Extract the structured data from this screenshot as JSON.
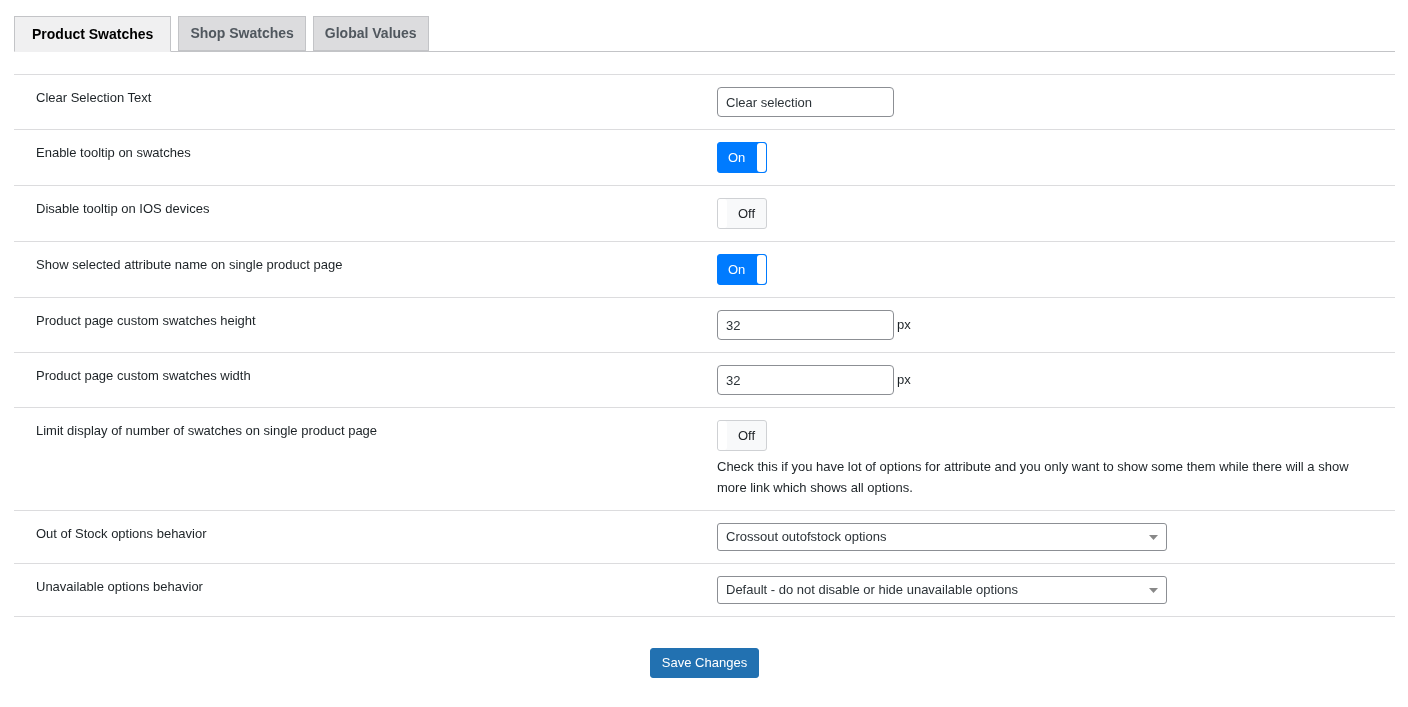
{
  "tabs": [
    {
      "label": "Product Swatches",
      "selected": true
    },
    {
      "label": "Shop Swatches",
      "selected": false
    },
    {
      "label": "Global Values",
      "selected": false
    }
  ],
  "settings": [
    {
      "kind": "text",
      "label": "Clear Selection Text",
      "value": "Clear selection"
    },
    {
      "kind": "toggle",
      "label": "Enable tooltip on swatches",
      "on": true,
      "text": "On"
    },
    {
      "kind": "toggle",
      "label": "Disable tooltip on IOS devices",
      "on": false,
      "text": "Off"
    },
    {
      "kind": "toggle",
      "label": "Show selected attribute name on single product page",
      "on": true,
      "text": "On"
    },
    {
      "kind": "number",
      "label": "Product page custom swatches height",
      "value": "32",
      "unit": "px"
    },
    {
      "kind": "number",
      "label": "Product page custom swatches width",
      "value": "32",
      "unit": "px"
    },
    {
      "kind": "toggle",
      "label": "Limit display of number of swatches on single product page",
      "on": false,
      "text": "Off",
      "description": "Check this if you have lot of options for attribute and you only want to show some them while there will a show more link which shows all options."
    },
    {
      "kind": "select",
      "label": "Out of Stock options behavior",
      "value": "Crossout outofstock options"
    },
    {
      "kind": "select",
      "label": "Unavailable options behavior",
      "value": "Default - do not disable or hide unavailable options"
    }
  ],
  "save_button": "Save Changes"
}
